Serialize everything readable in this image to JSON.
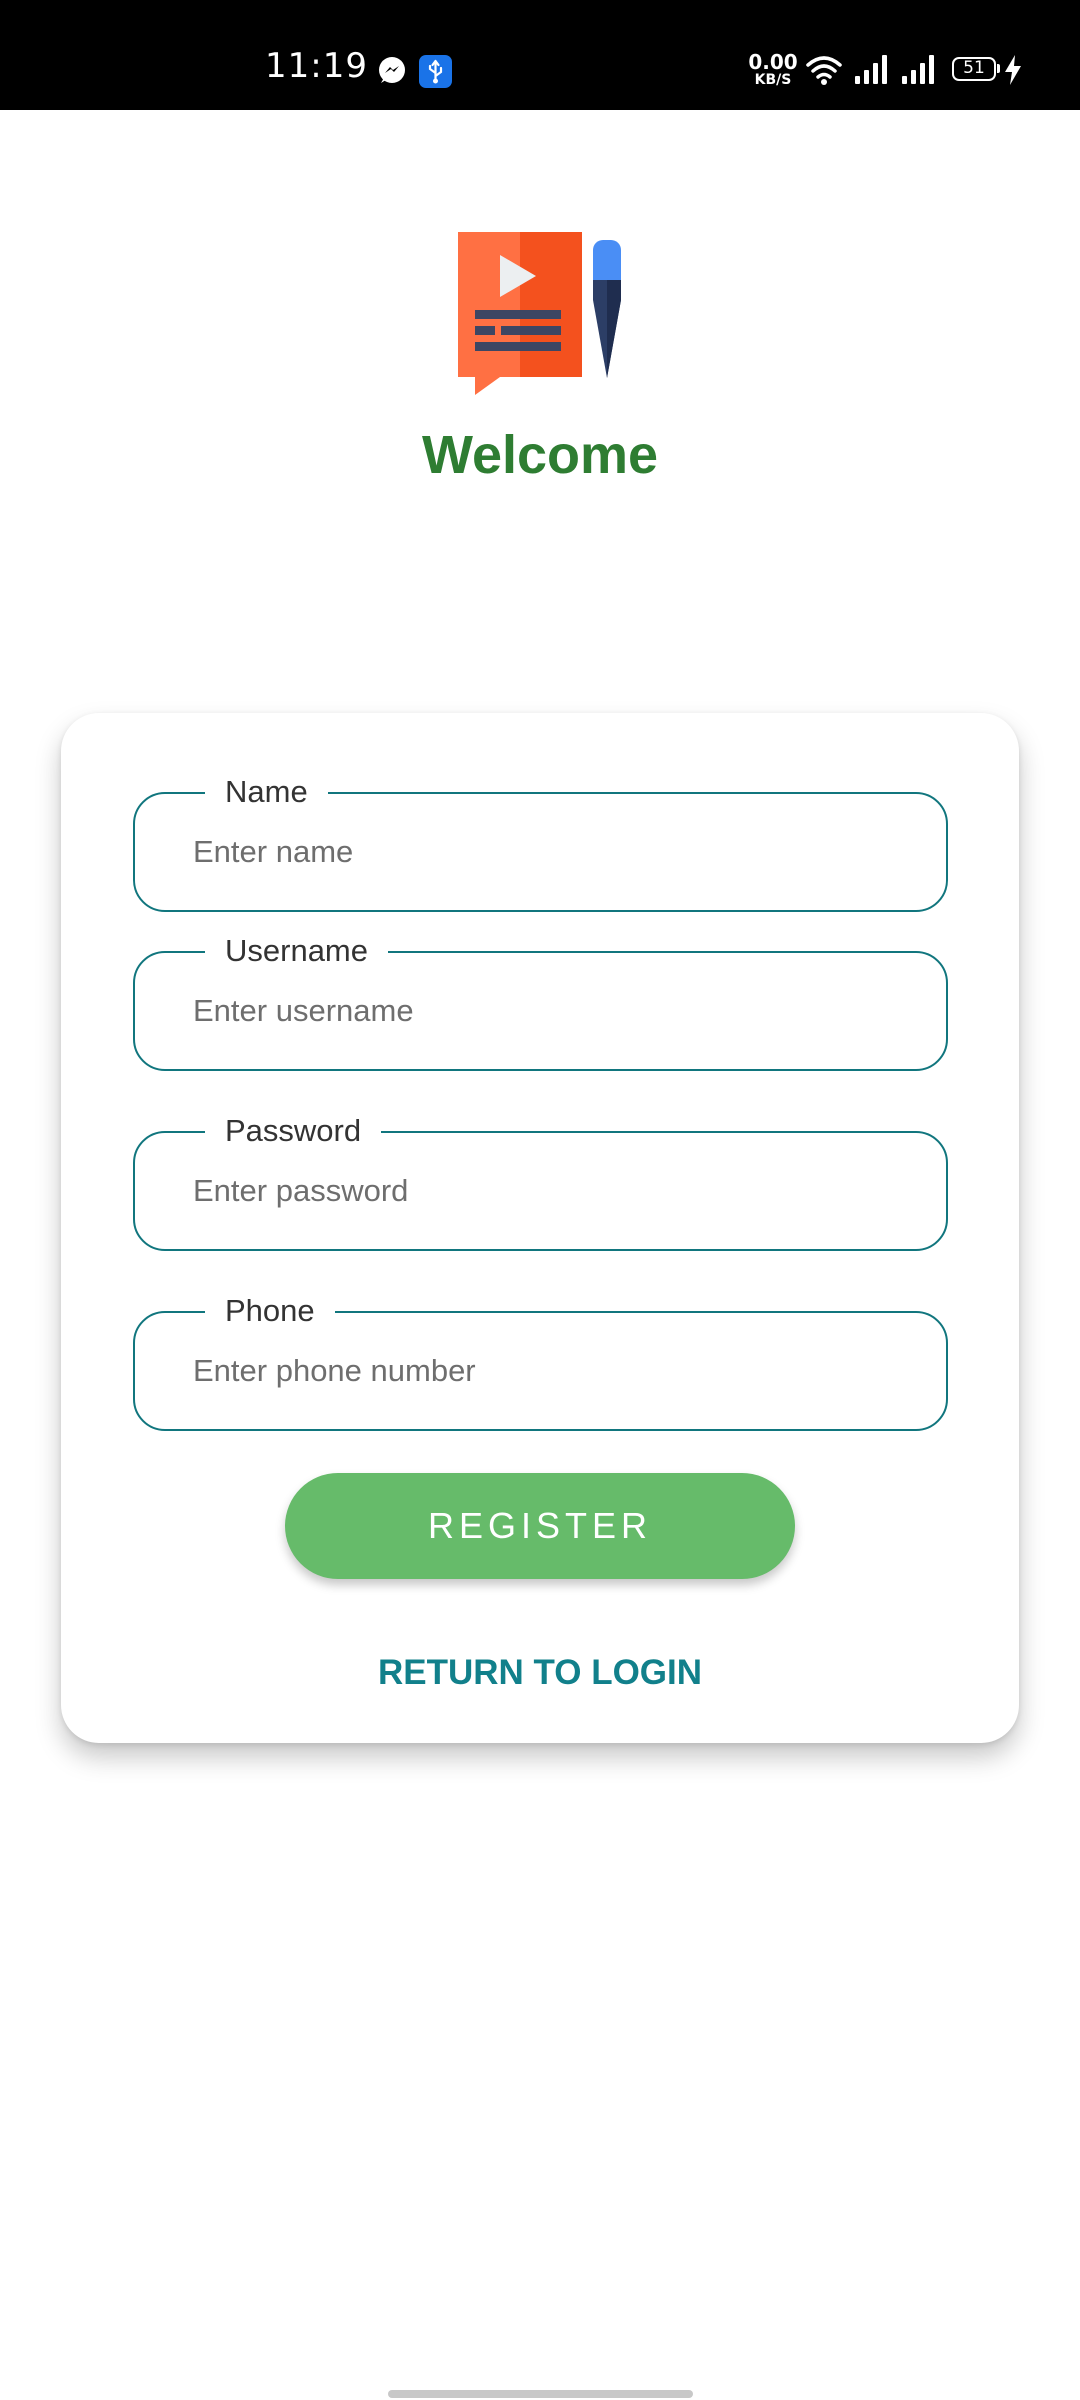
{
  "status_bar": {
    "time": "11:19",
    "net_speed_value": "0.00",
    "net_speed_unit": "KB/S",
    "battery": "51",
    "icons": [
      "messenger-icon",
      "usb-debug-icon",
      "wifi-icon",
      "signal-icon",
      "signal-icon",
      "charging-icon"
    ]
  },
  "header": {
    "logo": "video-document-pen-icon",
    "title": "Welcome"
  },
  "form": {
    "fields": [
      {
        "label": "Name",
        "placeholder": "Enter name",
        "value": ""
      },
      {
        "label": "Username",
        "placeholder": "Enter username",
        "value": ""
      },
      {
        "label": "Password",
        "placeholder": "Enter password",
        "value": ""
      },
      {
        "label": "Phone",
        "placeholder": "Enter phone number",
        "value": ""
      }
    ],
    "register_label": "REGISTER",
    "return_label": "RETURN TO LOGIN"
  },
  "colors": {
    "title_green": "#2e7d32",
    "field_border": "#11767e",
    "button_green": "#66bb6a",
    "link_teal": "#11808b"
  }
}
